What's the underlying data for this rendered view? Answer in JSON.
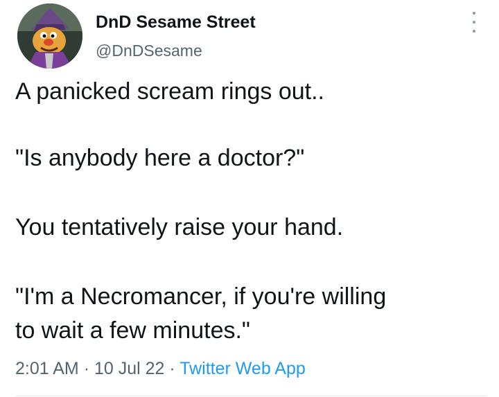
{
  "tweet": {
    "display_name": "DnD Sesame Street",
    "handle": "@DnDSesame",
    "more_icon": "more-horizontal-icon",
    "body_lines": [
      "A panicked scream rings out..",
      "\"Is anybody here a doctor?\"",
      "You tentatively raise your hand.",
      "\"I'm a Necromancer, if you're willing",
      "to wait a few minutes.\""
    ],
    "time": "2:01 AM",
    "separator": "·",
    "date": "10 Jul 22",
    "source": "Twitter Web App"
  },
  "colors": {
    "text": "#0f1419",
    "secondary": "#536471",
    "link": "#1d9bf0",
    "divider": "#e6ecf0"
  }
}
